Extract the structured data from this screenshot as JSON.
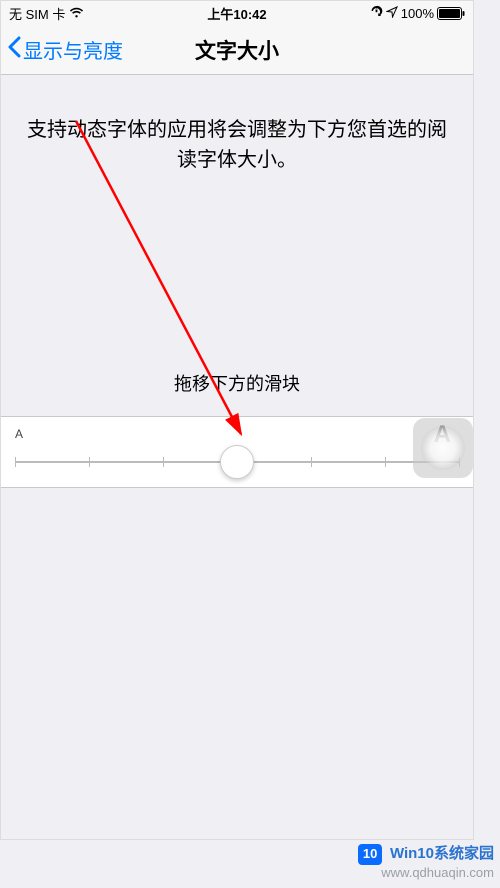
{
  "status": {
    "carrier": "无 SIM 卡",
    "time": "上午10:42",
    "battery_pct": "100%"
  },
  "nav": {
    "back_label": "显示与亮度",
    "title": "文字大小"
  },
  "body": {
    "description": "支持动态字体的应用将会调整为下方您首选的阅读字体大小。",
    "slider_hint": "拖移下方的滑块",
    "small_a": "A",
    "big_a": "A",
    "slider": {
      "steps": 7,
      "position": 3
    }
  },
  "watermark": {
    "badge": "10",
    "line1": "Win10系统家园",
    "line2": "www.qdhuaqin.com"
  }
}
